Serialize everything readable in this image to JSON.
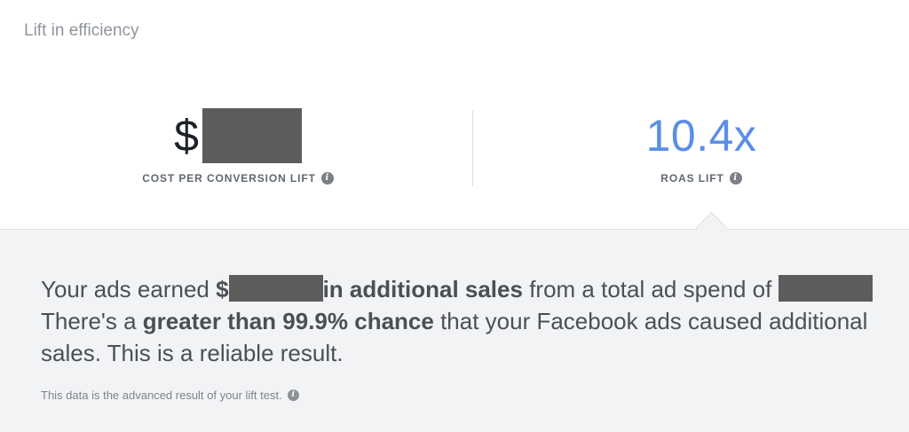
{
  "section_title": "Lift in efficiency",
  "metrics": {
    "cost": {
      "currency_symbol": "$",
      "label": "COST PER CONVERSION LIFT"
    },
    "roas": {
      "value": "10.4x",
      "label": "ROAS LIFT"
    }
  },
  "summary": {
    "part1": "Your ads earned ",
    "currency_symbol": "$",
    "part2_bold": "in additional sales",
    "part3": " from a total ad spend of ",
    "part4": "There's a ",
    "part5_bold": "greater than 99.9% chance",
    "part6": " that your Facebook ads caused additional sales. This is a reliable result."
  },
  "footnote": "This data is the advanced result of your lift test.",
  "icons": {
    "info": "info-icon"
  },
  "colors": {
    "roas_value": "#5b8ee6",
    "redaction": "#5c5c5c",
    "panel_background": "#f2f3f5"
  }
}
